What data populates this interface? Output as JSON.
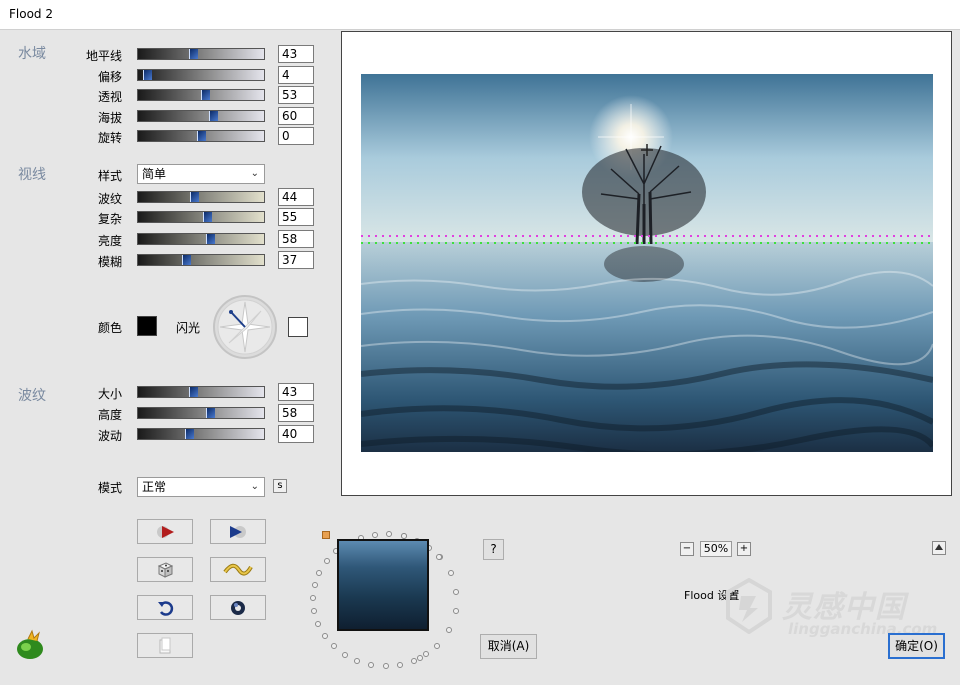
{
  "window": {
    "title": "Flood 2"
  },
  "water": {
    "title": "水域",
    "sliders": [
      {
        "label": "地平线",
        "value": "43",
        "level": 0.43
      },
      {
        "label": "偏移",
        "value": "4",
        "level": 0.04
      },
      {
        "label": "透视",
        "value": "53",
        "level": 0.53
      },
      {
        "label": "海拔",
        "value": "60",
        "level": 0.6
      },
      {
        "label": "旋转",
        "value": "0",
        "level": 0.5
      }
    ]
  },
  "view": {
    "title": "视线",
    "style_label": "样式",
    "style_value": "简单",
    "sliders": [
      {
        "label": "波纹",
        "value": "44",
        "level": 0.44
      },
      {
        "label": "复杂",
        "value": "55",
        "level": 0.55
      },
      {
        "label": "亮度",
        "value": "58",
        "level": 0.58
      },
      {
        "label": "模糊",
        "value": "37",
        "level": 0.37
      }
    ],
    "color_label": "颜色",
    "color": "#000000",
    "glint_label": "闪光",
    "glint_color": "#ffffff"
  },
  "ripple": {
    "title": "波纹",
    "sliders": [
      {
        "label": "大小",
        "value": "43",
        "level": 0.43
      },
      {
        "label": "高度",
        "value": "58",
        "level": 0.58
      },
      {
        "label": "波动",
        "value": "40",
        "level": 0.4
      }
    ]
  },
  "mode": {
    "label": "模式",
    "value": "正常"
  },
  "zoom": {
    "minus": "−",
    "value": "50%",
    "plus": "+"
  },
  "settings_label": "Flood 设置",
  "buttons": {
    "cancel": "取消(A)",
    "ok": "确定(O)",
    "help": "?"
  },
  "watermark": {
    "brand": "灵感中国",
    "url": "lingganchina.com"
  },
  "icons": [
    "play-forward-icon",
    "play-back-icon",
    "dice-icon",
    "wave-icon",
    "undo-icon",
    "ring-icon",
    "page-icon",
    "flood-logo-icon",
    "compass-icon",
    "crosshair-icon"
  ]
}
